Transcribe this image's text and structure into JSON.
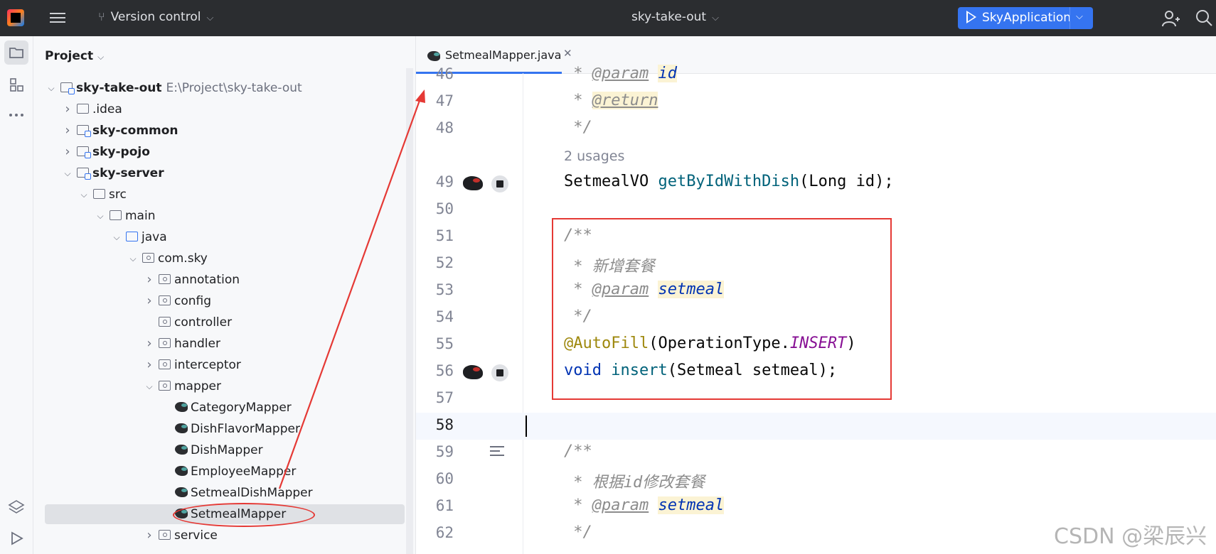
{
  "titlebar": {
    "vcs_label": "Version control",
    "project_name": "sky-take-out",
    "run_config": "SkyApplication"
  },
  "project_panel": {
    "title": "Project",
    "tree": [
      {
        "label": "sky-take-out",
        "path": "E:\\Project\\sky-take-out",
        "bold": true,
        "depth": 0,
        "state": "open",
        "icon": "module-folder-icon"
      },
      {
        "label": ".idea",
        "depth": 1,
        "state": "closed",
        "icon": "folder-icon"
      },
      {
        "label": "sky-common",
        "bold": true,
        "depth": 1,
        "state": "closed",
        "icon": "module-folder-icon"
      },
      {
        "label": "sky-pojo",
        "bold": true,
        "depth": 1,
        "state": "closed",
        "icon": "module-folder-icon"
      },
      {
        "label": "sky-server",
        "bold": true,
        "depth": 1,
        "state": "open",
        "icon": "module-folder-icon"
      },
      {
        "label": "src",
        "depth": 2,
        "state": "open",
        "icon": "folder-icon"
      },
      {
        "label": "main",
        "depth": 3,
        "state": "open",
        "icon": "folder-icon"
      },
      {
        "label": "java",
        "depth": 4,
        "state": "open",
        "icon": "source-folder-icon"
      },
      {
        "label": "com.sky",
        "depth": 5,
        "state": "open",
        "icon": "package-icon"
      },
      {
        "label": "annotation",
        "depth": 6,
        "state": "closed",
        "icon": "package-icon"
      },
      {
        "label": "config",
        "depth": 6,
        "state": "closed",
        "icon": "package-icon"
      },
      {
        "label": "controller",
        "depth": 6,
        "state": "none",
        "icon": "package-icon"
      },
      {
        "label": "handler",
        "depth": 6,
        "state": "closed",
        "icon": "package-icon"
      },
      {
        "label": "interceptor",
        "depth": 6,
        "state": "closed",
        "icon": "package-icon"
      },
      {
        "label": "mapper",
        "depth": 6,
        "state": "open",
        "icon": "package-icon"
      },
      {
        "label": "CategoryMapper",
        "depth": 7,
        "state": "none",
        "icon": "mybatis-mapper-icon"
      },
      {
        "label": "DishFlavorMapper",
        "depth": 7,
        "state": "none",
        "icon": "mybatis-mapper-icon"
      },
      {
        "label": "DishMapper",
        "depth": 7,
        "state": "none",
        "icon": "mybatis-mapper-icon"
      },
      {
        "label": "EmployeeMapper",
        "depth": 7,
        "state": "none",
        "icon": "mybatis-mapper-icon"
      },
      {
        "label": "SetmealDishMapper",
        "depth": 7,
        "state": "none",
        "icon": "mybatis-mapper-icon"
      },
      {
        "label": "SetmealMapper",
        "depth": 7,
        "state": "none",
        "icon": "mybatis-mapper-icon",
        "selected": true
      },
      {
        "label": "service",
        "depth": 6,
        "state": "closed",
        "icon": "package-icon"
      }
    ]
  },
  "editor": {
    "tab_label": "SetmealMapper.java",
    "usages_label": "2 usages",
    "lines": {
      "n46": "46",
      "n47": "47",
      "n48": "48",
      "n49": "49",
      "n50": "50",
      "n51": "51",
      "n52": "52",
      "n53": "53",
      "n54": "54",
      "n55": "55",
      "n56": "56",
      "n57": "57",
      "n58": "58",
      "n59": "59",
      "n60": "60",
      "n61": "61",
      "n62": "62"
    },
    "code": {
      "l46_star": " * ",
      "l46_tag": "@param",
      "l46_name": "id",
      "l47_star": " * ",
      "l47_tag": "@return",
      "l48": " */",
      "l49_type": "SetmealVO ",
      "l49_fn": "getByIdWithDish",
      "l49_rest": "(Long id);",
      "l51": "/**",
      "l52": " * 新增套餐",
      "l53_star": " * ",
      "l53_tag": "@param",
      "l53_name": "setmeal",
      "l54": " */",
      "l55_ann": "@AutoFill",
      "l55_mid": "(OperationType.",
      "l55_const": "INSERT",
      "l55_end": ")",
      "l56_kw": "void ",
      "l56_fn": "insert",
      "l56_rest": "(Setmeal setmeal);",
      "l59": "/**",
      "l60": " * 根据id修改套餐",
      "l61_star": " * ",
      "l61_tag": "@param",
      "l61_name": "setmeal",
      "l62": " */"
    },
    "current_line": 58
  },
  "watermark": "CSDN @梁辰兴",
  "colors": {
    "accent": "#3574f0",
    "annotation_red": "#e53935",
    "titlebar_bg": "#2b2d30"
  }
}
